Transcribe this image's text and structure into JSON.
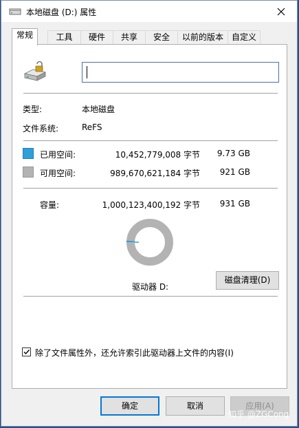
{
  "window": {
    "title": "本地磁盘 (D:) 属性"
  },
  "tabs": [
    {
      "label": "常规",
      "active": true
    },
    {
      "label": "工具"
    },
    {
      "label": "硬件"
    },
    {
      "label": "共享"
    },
    {
      "label": "安全"
    },
    {
      "label": "以前的版本"
    },
    {
      "label": "自定义"
    }
  ],
  "general": {
    "name_value": "",
    "type_label": "类型:",
    "type_value": "本地磁盘",
    "fs_label": "文件系统:",
    "fs_value": "ReFS",
    "used": {
      "label": "已用空间:",
      "bytes": "10,452,779,008 字节",
      "size": "9.73 GB",
      "color": "#2f9fd8"
    },
    "free": {
      "label": "可用空间:",
      "bytes": "989,670,621,184 字节",
      "size": "921 GB",
      "color": "#b3b3b3"
    },
    "capacity": {
      "label": "容量:",
      "bytes": "1,000,123,400,192 字节",
      "size": "931 GB"
    },
    "used_fraction": 0.0105,
    "drive_label": "驱动器 D:",
    "cleanup_button": "磁盘清理(D)",
    "index_checkbox": {
      "label": "除了文件属性外，还允许索引此驱动器上文件的内容(I)",
      "checked": true
    }
  },
  "buttons": {
    "ok": "确定",
    "cancel": "取消",
    "apply": "应用(A)"
  },
  "watermark": "知乎 @ZGCong"
}
